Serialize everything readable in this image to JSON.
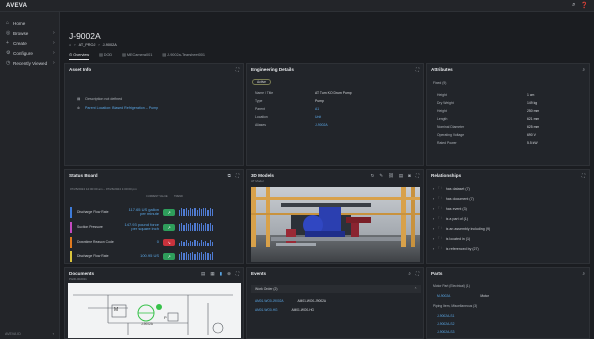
{
  "app": {
    "logo": "AVEVA"
  },
  "header_icons": [
    "search-icon",
    "help-icon"
  ],
  "sidebar": {
    "items": [
      {
        "label": "Home",
        "icon": "home-icon",
        "chevron": ""
      },
      {
        "label": "Browse",
        "icon": "browse-icon",
        "chevron": "›"
      },
      {
        "label": "Create",
        "icon": "plus-icon",
        "chevron": "›"
      },
      {
        "label": "Configure",
        "icon": "gear-icon",
        "chevron": "›"
      },
      {
        "label": "Recently Viewed",
        "icon": "clock-icon",
        "chevron": "›"
      }
    ],
    "footer": "AVEVA ID"
  },
  "page": {
    "title": "J-9002A",
    "breadcrumb": [
      "AT_PROJ",
      "J-9002A"
    ],
    "tabs": [
      "Overview",
      "DOD",
      "MECamera001",
      "J-9002a-Tearsheet001"
    ]
  },
  "asset_info": {
    "title": "Asset Info",
    "description": "Description not defined",
    "link": "Parent Location: Biased Refrigeration – Pump"
  },
  "engineering": {
    "title": "Engineering Details",
    "badge": "Active",
    "rows": [
      {
        "k": "Name / Title",
        "v": "AT Turn KO Drum Pump",
        "link": false
      },
      {
        "k": "Type",
        "v": "Pump",
        "link": false
      },
      {
        "k": "Parent",
        "v": "A1",
        "link": true
      },
      {
        "k": "Location",
        "v": "Unit",
        "link": true
      },
      {
        "k": "Aliases",
        "v": "J-9002A",
        "link": true
      }
    ]
  },
  "attributes": {
    "title": "Attributes",
    "group": "Fixed (9)",
    "rows": [
      {
        "k": "Height",
        "v": "1 cm"
      },
      {
        "k": "Dry Weight",
        "v": "149 kg"
      },
      {
        "k": "Height",
        "v": "250 mm"
      },
      {
        "k": "Length",
        "v": "621 mm"
      },
      {
        "k": "Nominal Diameter",
        "v": "625 mm"
      },
      {
        "k": "Operating Voltage",
        "v": "690 V"
      },
      {
        "k": "Rated Power",
        "v": "5.5 kW"
      }
    ]
  },
  "status": {
    "title": "Status Board",
    "range": "07/25/2024 12:00:00 am – 07/26/2024 1:00:00 pm",
    "col_value": "CURRENT VALUE",
    "col_trend": "TREND",
    "rows": [
      {
        "name": "Discharge Flow Rate",
        "value": "117.65 US gallon per minute",
        "color": "#3d7bd9",
        "trend": "#2e9e5b"
      },
      {
        "name": "Suction Pressure",
        "value": "147.93 pound force per square inch",
        "color": "#c44ac0",
        "trend": "#2e9e5b"
      },
      {
        "name": "Downtime Reason Code",
        "value": "0",
        "color": "#e07a1f",
        "trend": "#c8323c"
      },
      {
        "name": "Discharge Flow Rate",
        "value": "100.95 US",
        "color": "#d9c43d",
        "trend": "#2e9e5b"
      }
    ]
  },
  "models3d": {
    "title": "3D Models",
    "subtitle": "AT Model"
  },
  "relationships": {
    "title": "Relationships",
    "items": [
      "has dataset (7)",
      "has document (7)",
      "has event (3)",
      "is a part of (1)",
      "is an assembly including (9)",
      "is located in (1)",
      "is referenced by (27)"
    ]
  },
  "documents": {
    "title": "Documents",
    "subtitle": "P&ID-002011",
    "tag": "J-9002A",
    "symbol_m": "M",
    "symbol_p": "P"
  },
  "events": {
    "title": "Events",
    "group": "Work Order (2)",
    "rows": [
      {
        "a": "AM01-WO0-J9002A",
        "b": "AM01-WO0-J9002A"
      },
      {
        "a": "AM01-WO0-HG",
        "b": "AM01-WO0-HG"
      }
    ]
  },
  "parts": {
    "title": "Parts",
    "group1": "Motor Part (Electrical) (1)",
    "part1": "M-9002A",
    "part1_type": "Motor",
    "group2": "Piping Item, Miscellaneous (3)",
    "links": [
      "J-9002A-S1",
      "J-9002A-S2",
      "J-9002A-S3"
    ]
  }
}
